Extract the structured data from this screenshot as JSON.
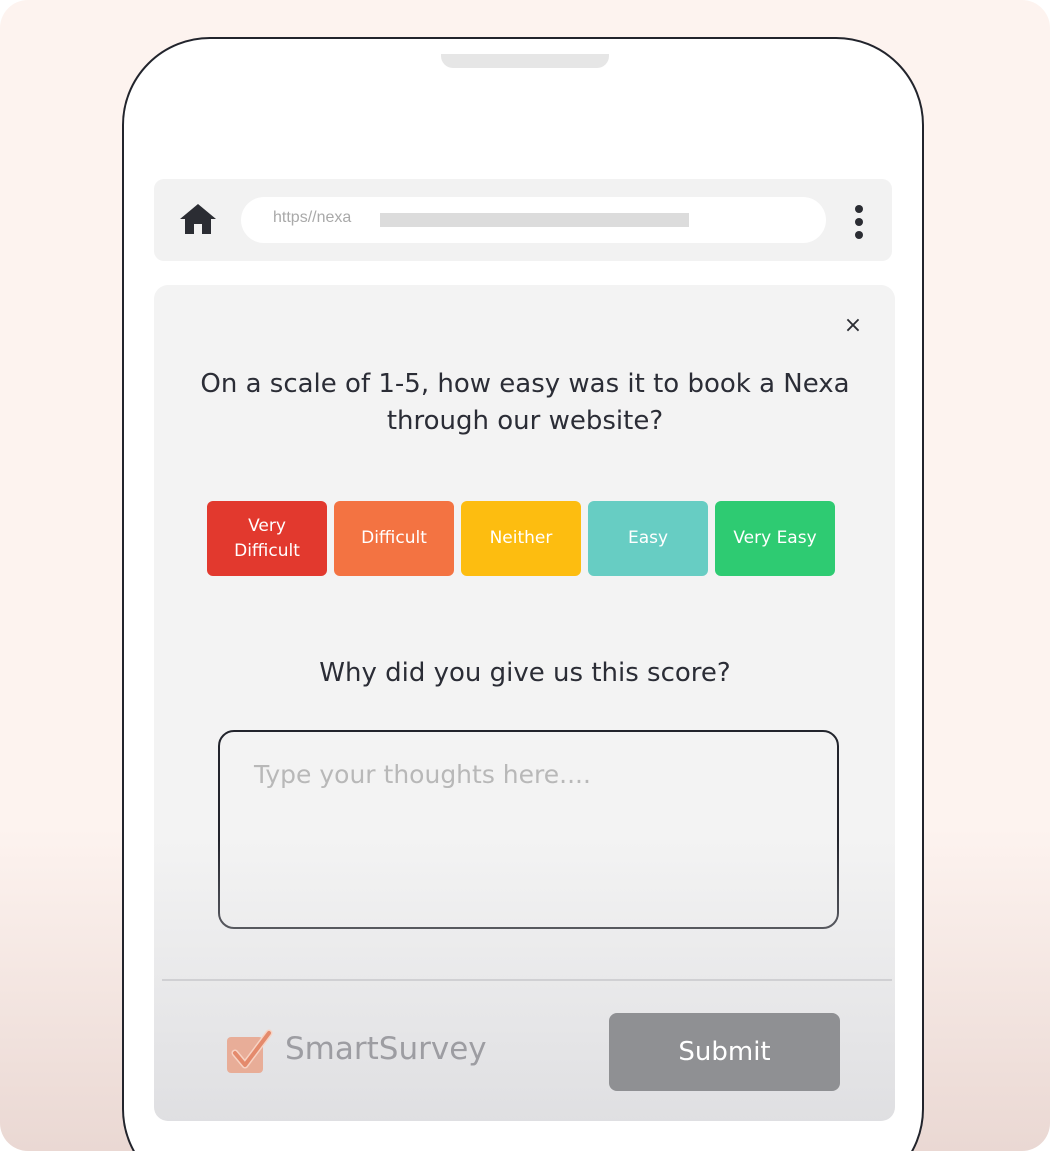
{
  "browser": {
    "url_text": "https//nexa",
    "home_icon": "home-icon",
    "menu_icon": "kebab-menu-icon"
  },
  "survey": {
    "close_icon": "close-icon",
    "close_glyph": "×",
    "question": "On a scale of 1-5, how easy was it to book a Nexa through our website?",
    "options": [
      {
        "label": "Very Difficult",
        "color": "#e2392e"
      },
      {
        "label": "Difficult",
        "color": "#f37342"
      },
      {
        "label": "Neither",
        "color": "#fdbd10"
      },
      {
        "label": "Easy",
        "color": "#67cdc3"
      },
      {
        "label": "Very Easy",
        "color": "#2ecb72"
      }
    ],
    "followup_question": "Why did you give us this score?",
    "comment_placeholder": "Type your thoughts here....",
    "submit_label": "Submit"
  },
  "footer": {
    "brand_name": "SmartSurvey",
    "brand_icon": "checkmark-logo-icon",
    "brand_color": "#e9967a"
  }
}
